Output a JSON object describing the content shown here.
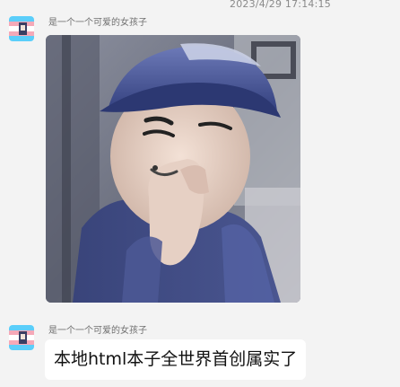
{
  "chat": {
    "timestamp": "2023/4/29 17:14:15",
    "messages": [
      {
        "sender": "是一个一个可爱的女孩子",
        "type": "image"
      },
      {
        "sender": "是一个一个可爱的女孩子",
        "type": "text",
        "text": "本地html本子全世界首创属实了"
      }
    ]
  },
  "colors": {
    "background": "#f3f3f3",
    "bubble": "#ffffff",
    "avatar_blue": "#5bcefa",
    "avatar_pink": "#f5a9b8"
  }
}
